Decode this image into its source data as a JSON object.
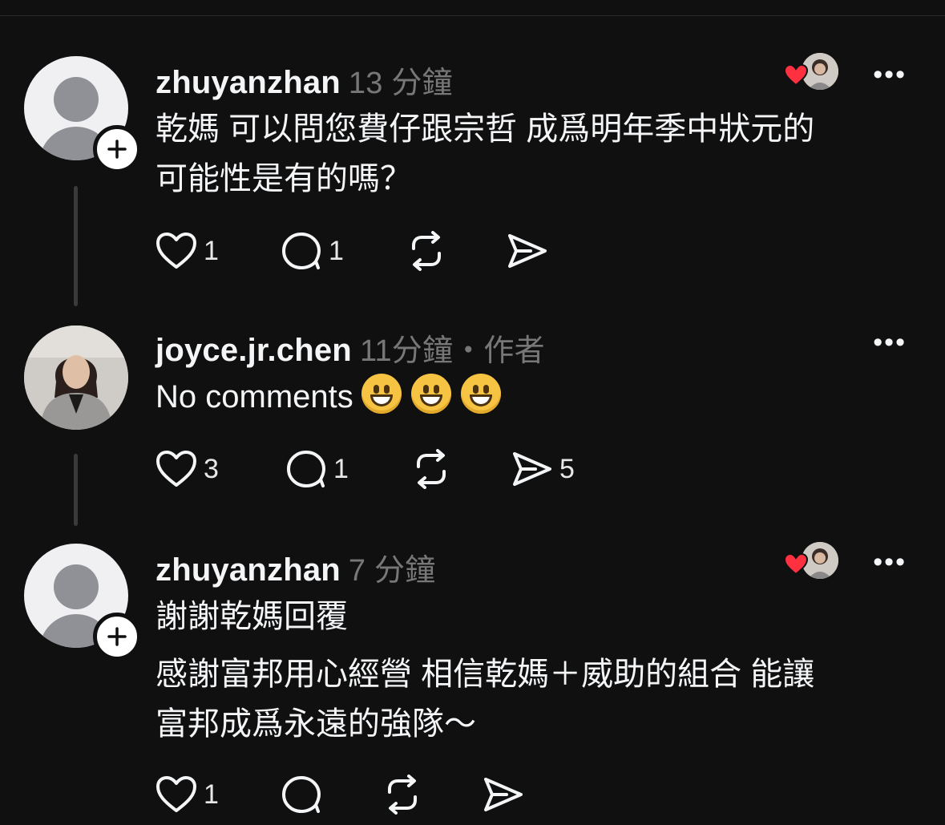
{
  "posts": [
    {
      "username": "zhuyanzhan",
      "time": "13 分鐘",
      "author_tag": "",
      "text_lines": [
        "乾媽 可以問您費仔跟宗哲 成爲明年季中狀元的",
        "可能性是有的嗎？"
      ],
      "likes": "1",
      "replies": "1",
      "reposts": "",
      "shares": "",
      "liked_by_author": true
    },
    {
      "username": "joyce.jr.chen",
      "time": "11分鐘",
      "author_tag": "・作者",
      "text": "No comments",
      "likes": "3",
      "replies": "1",
      "reposts": "",
      "shares": "5",
      "liked_by_author": false
    },
    {
      "username": "zhuyanzhan",
      "time": "7 分鐘",
      "author_tag": "",
      "text_lines": [
        "謝謝乾媽回覆",
        "感謝富邦用心經營 相信乾媽＋威助的組合 能讓",
        "富邦成爲永遠的強隊～"
      ],
      "likes": "1",
      "replies": "",
      "reposts": "",
      "shares": "",
      "liked_by_author": true
    }
  ],
  "icons": {
    "more": "more-icon",
    "like": "heart-outline-icon",
    "reply": "comment-bubble-icon",
    "repost": "repost-icon",
    "share": "send-icon",
    "follow": "plus-icon",
    "liked": "heart-filled-icon"
  },
  "colors": {
    "background": "#101010",
    "text": "#f3f5f7",
    "muted": "#777777",
    "heart": "#ff3040",
    "more_dots": "•••"
  }
}
